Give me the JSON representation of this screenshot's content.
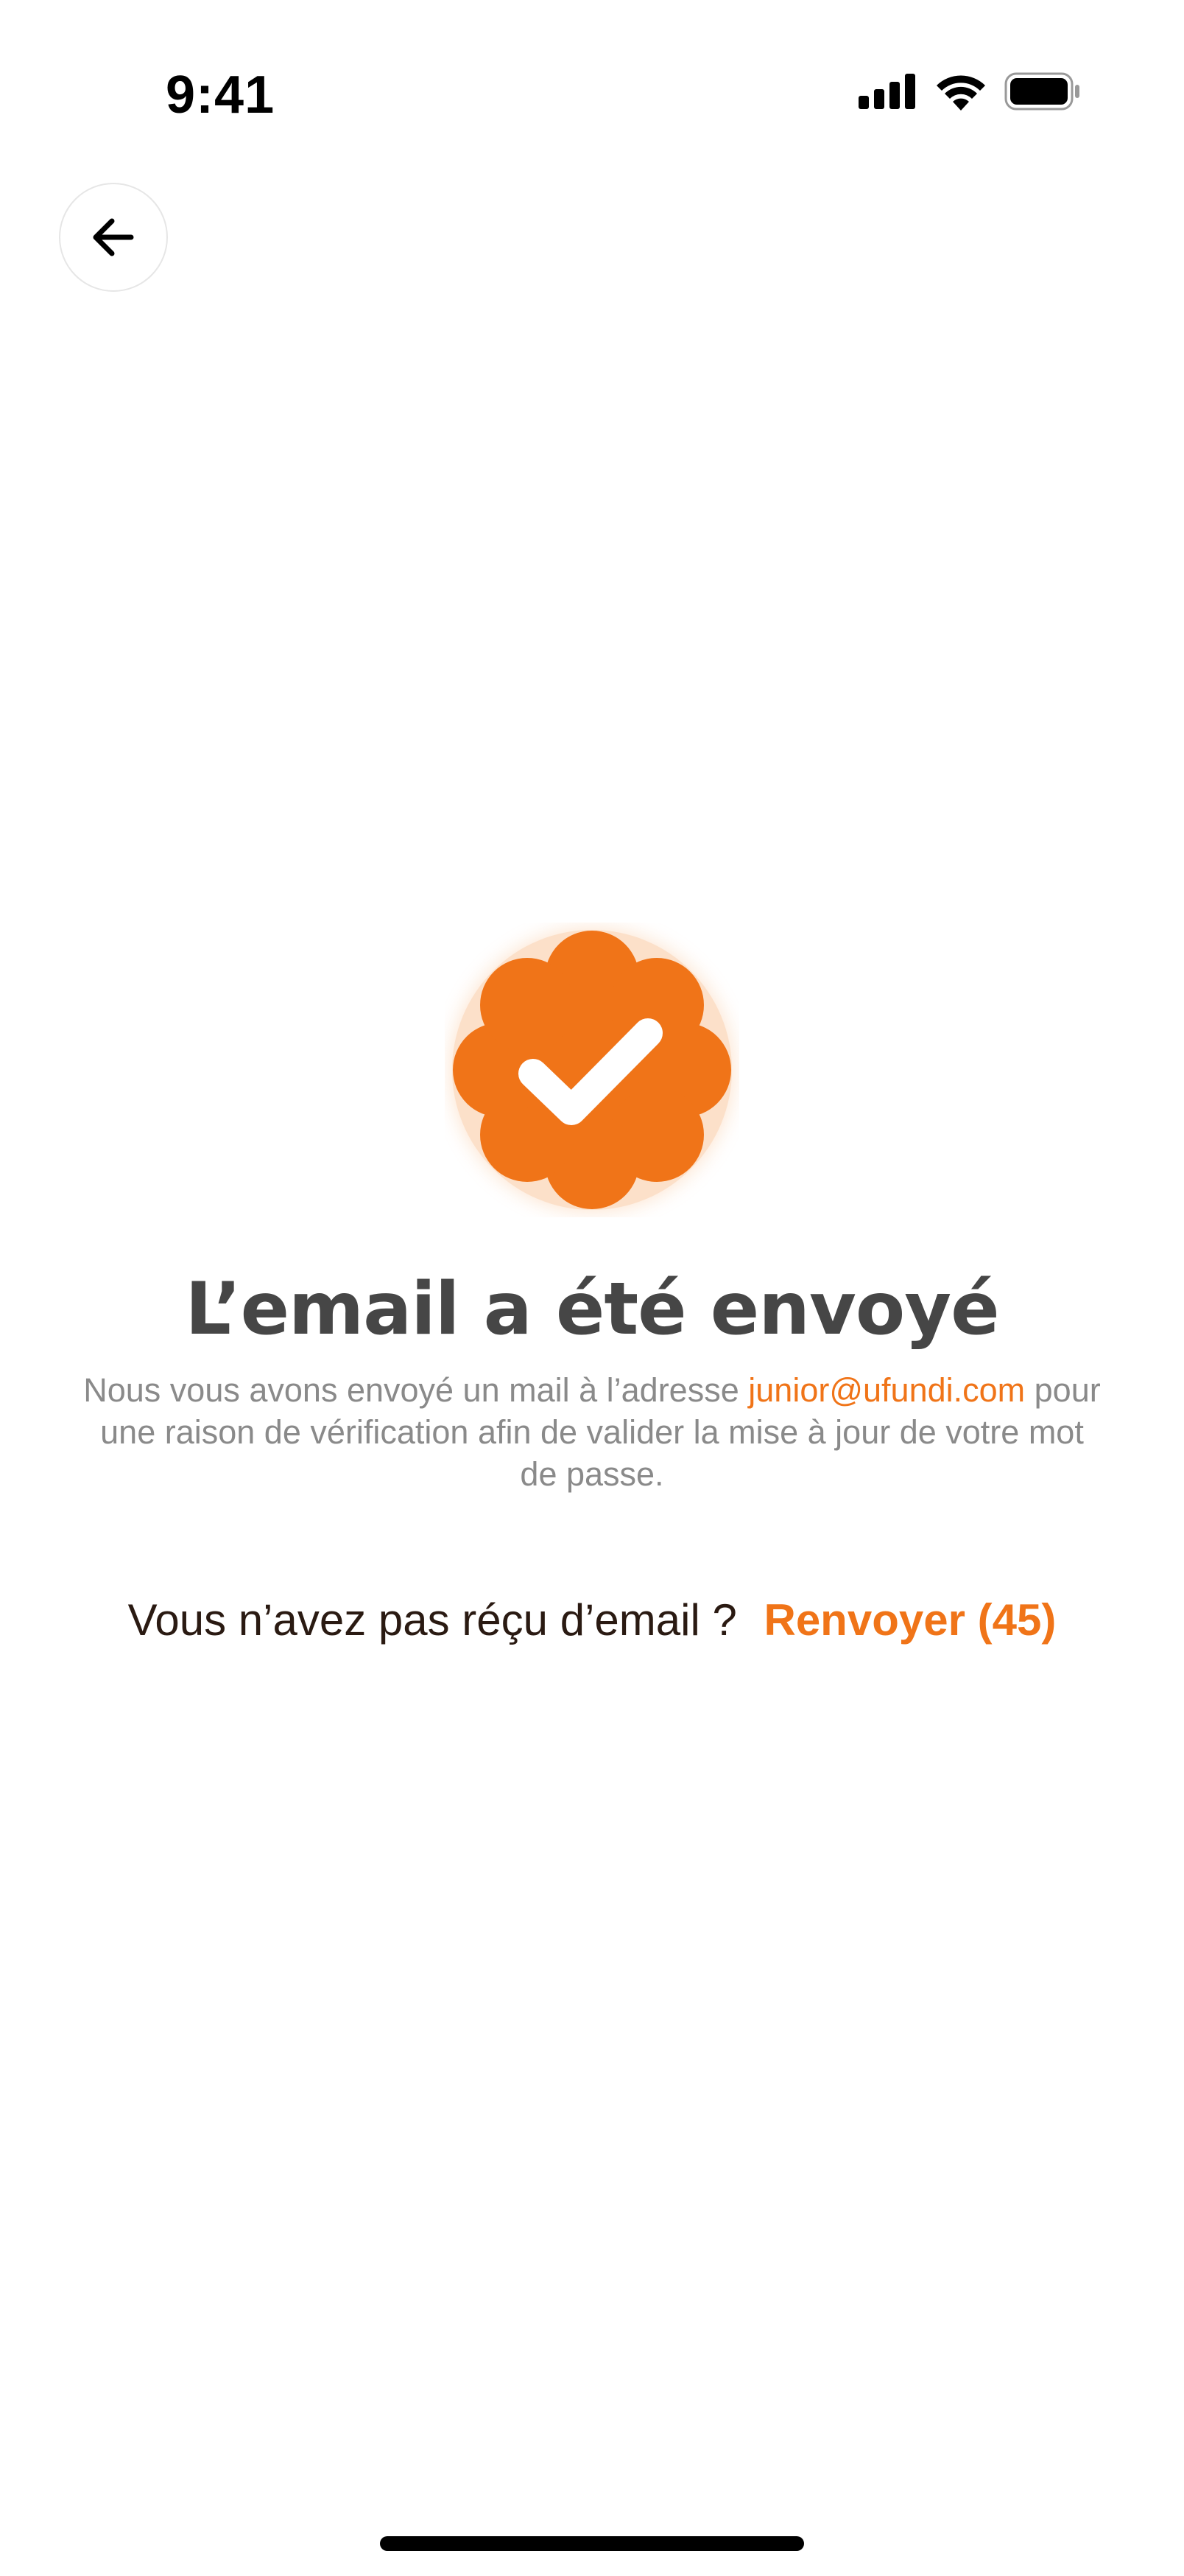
{
  "status_bar": {
    "time": "9:41",
    "icons": [
      "cellular-signal-icon",
      "wifi-icon",
      "battery-icon"
    ]
  },
  "navigation": {
    "back_icon": "arrow-left-icon"
  },
  "confirmation": {
    "badge_icon": "verified-check-badge-icon",
    "title": "L’email a été envoyé",
    "description_prefix": "Nous vous avons envoyé un mail à l’adresse",
    "email": "junior@ufundi.com",
    "description_suffix": "pour une raison de vérification afin de valider la mise à jour de votre mot de passe."
  },
  "resend": {
    "question": "Vous n’avez pas réçu d’email ?",
    "action_label": "Renvoyer (45)"
  },
  "colors": {
    "accent": "#f07418",
    "title": "#464646",
    "muted_text": "#8a8a8a",
    "body_text": "#2a1a12",
    "background": "#ffffff"
  }
}
